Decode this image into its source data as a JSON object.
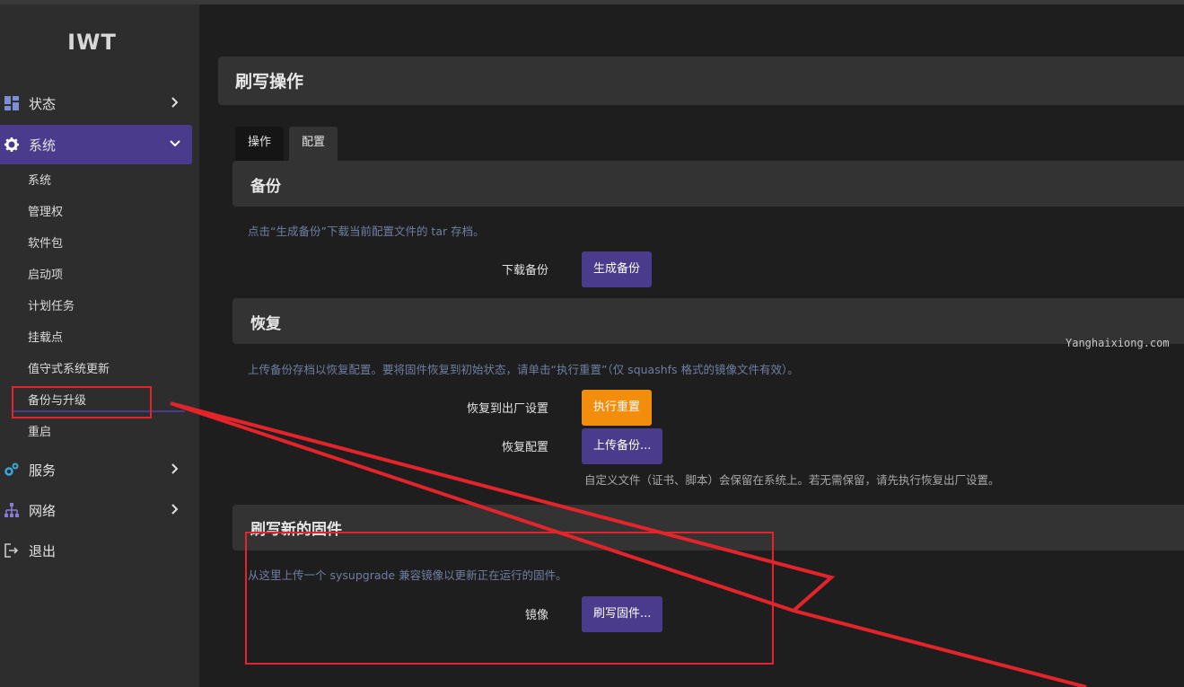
{
  "app": {
    "logo": "IWT"
  },
  "sidebar": {
    "items": [
      {
        "label": "状态",
        "icon": "dashboard-icon"
      },
      {
        "label": "系统",
        "icon": "gear-icon"
      },
      {
        "label": "服务",
        "icon": "services-icon"
      },
      {
        "label": "网络",
        "icon": "network-icon"
      },
      {
        "label": "退出",
        "icon": "logout-icon"
      }
    ],
    "system_sub": [
      "系统",
      "管理权",
      "软件包",
      "启动项",
      "计划任务",
      "挂载点",
      "值守式系统更新",
      "备份与升级",
      "重启"
    ]
  },
  "page": {
    "title": "刷写操作",
    "tabs": [
      "操作",
      "配置"
    ],
    "backup": {
      "title": "备份",
      "description": "点击“生成备份”下载当前配置文件的 tar 存档。",
      "download_label": "下载备份",
      "generate_button": "生成备份"
    },
    "restore": {
      "title": "恢复",
      "description": "上传备份存档以恢复配置。要将固件恢复到初始状态，请单击“执行重置”（仅 squashfs 格式的镜像文件有效）。",
      "factory_label": "恢复到出厂设置",
      "reset_button": "执行重置",
      "restore_label": "恢复配置",
      "upload_button": "上传备份...",
      "hint": "自定义文件（证书、脚本）会保留在系统上。若无需保留，请先执行恢复出厂设置。"
    },
    "flash": {
      "title": "刷写新的固件",
      "description": "从这里上传一个 sysupgrade 兼容镜像以更新正在运行的固件。",
      "image_label": "镜像",
      "flash_button": "刷写固件..."
    }
  },
  "watermark": "Yanghaixiong.com",
  "colors": {
    "accent": "#4a3b8c",
    "warning": "#f28e0c",
    "annotation": "#e3242b"
  }
}
